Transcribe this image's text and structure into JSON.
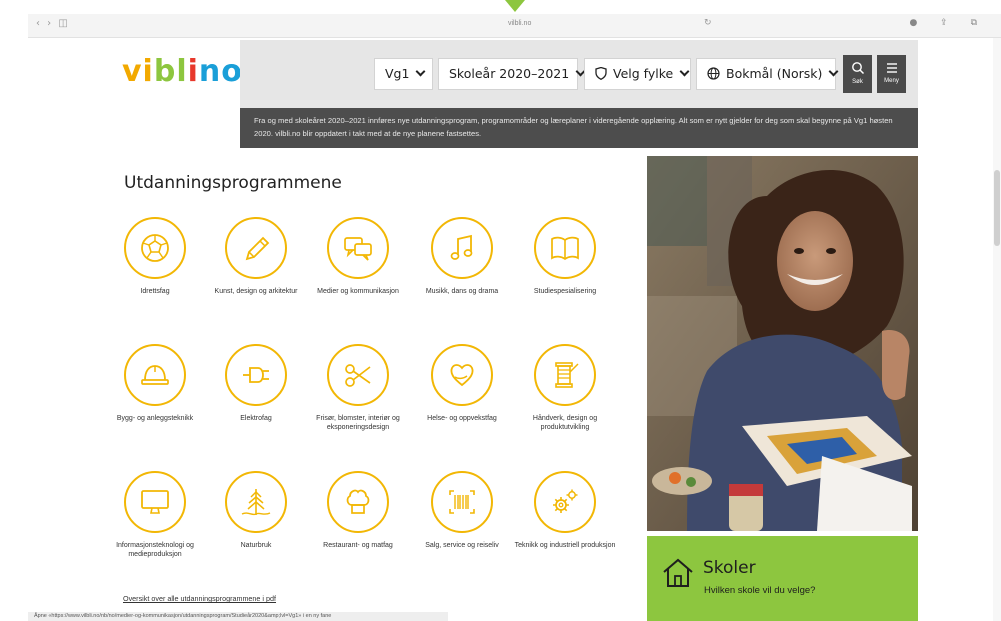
{
  "browser": {
    "nav_glyphs": "‹ › ◫",
    "url": "vilbli.no",
    "reload_glyph": "↻",
    "right_glyphs": "● ⇪ ⧉"
  },
  "site": {
    "logo_parts": [
      "vi",
      "bl",
      "i",
      "no"
    ]
  },
  "header": {
    "level": "Vg1",
    "school_year": "Skoleår 2020–2021",
    "county": "Velg fylke",
    "language": "Bokmål (Norsk)",
    "search_label": "Søk",
    "menu_label": "Meny"
  },
  "notice": "Fra og med skoleåret 2020–2021 innføres nye utdanningsprogram, programområder og læreplaner i videregående opplæring. Alt som er nytt gjelder for deg som skal begynne på Vg1 høsten 2020. vilbli.no blir oppdatert i takt med at de nye planene fastsettes.",
  "programs": {
    "title": "Utdanningsprogrammene",
    "items": [
      {
        "label": "Idrettsfag",
        "icon": "football-icon"
      },
      {
        "label": "Kunst, design og arkitektur",
        "icon": "pencil-icon"
      },
      {
        "label": "Medier og kommunikasjon",
        "icon": "speech-bubbles-icon"
      },
      {
        "label": "Musikk, dans og drama",
        "icon": "music-note-icon"
      },
      {
        "label": "Studiespesialisering",
        "icon": "open-book-icon"
      },
      {
        "label": "Bygg- og anleggsteknikk",
        "icon": "hard-hat-icon"
      },
      {
        "label": "Elektrofag",
        "icon": "plug-icon"
      },
      {
        "label": "Frisør, blomster, interiør og eksponeringsdesign",
        "icon": "scissors-icon"
      },
      {
        "label": "Helse- og oppvekstfag",
        "icon": "heart-hand-icon"
      },
      {
        "label": "Håndverk, design og produktutvikling",
        "icon": "thread-spool-icon"
      },
      {
        "label": "Informasjonsteknologi og medieproduksjon",
        "icon": "monitor-icon"
      },
      {
        "label": "Naturbruk",
        "icon": "tree-icon"
      },
      {
        "label": "Restaurant- og matfag",
        "icon": "chef-hat-icon"
      },
      {
        "label": "Salg, service og reiseliv",
        "icon": "barcode-icon"
      },
      {
        "label": "Teknikk og industriell produksjon",
        "icon": "gears-icon"
      }
    ],
    "pdf_link": "Oversikt over alle utdanningsprogrammene i pdf"
  },
  "status_bar": "Åpne «https://www.vilbli.no/nb/no/medier-og-kommunikasjon/utdanningsprogram/Studieår2020&amp;lvl=Vg1» i en ny fane",
  "skoler": {
    "title": "Skoler",
    "subtitle": "Hvilken skole vil du velge?"
  },
  "colors": {
    "accent_yellow": "#f2b705",
    "green": "#8dc63f",
    "dark_bar": "#4d4d4d",
    "header_grey": "#e6e6e6"
  }
}
